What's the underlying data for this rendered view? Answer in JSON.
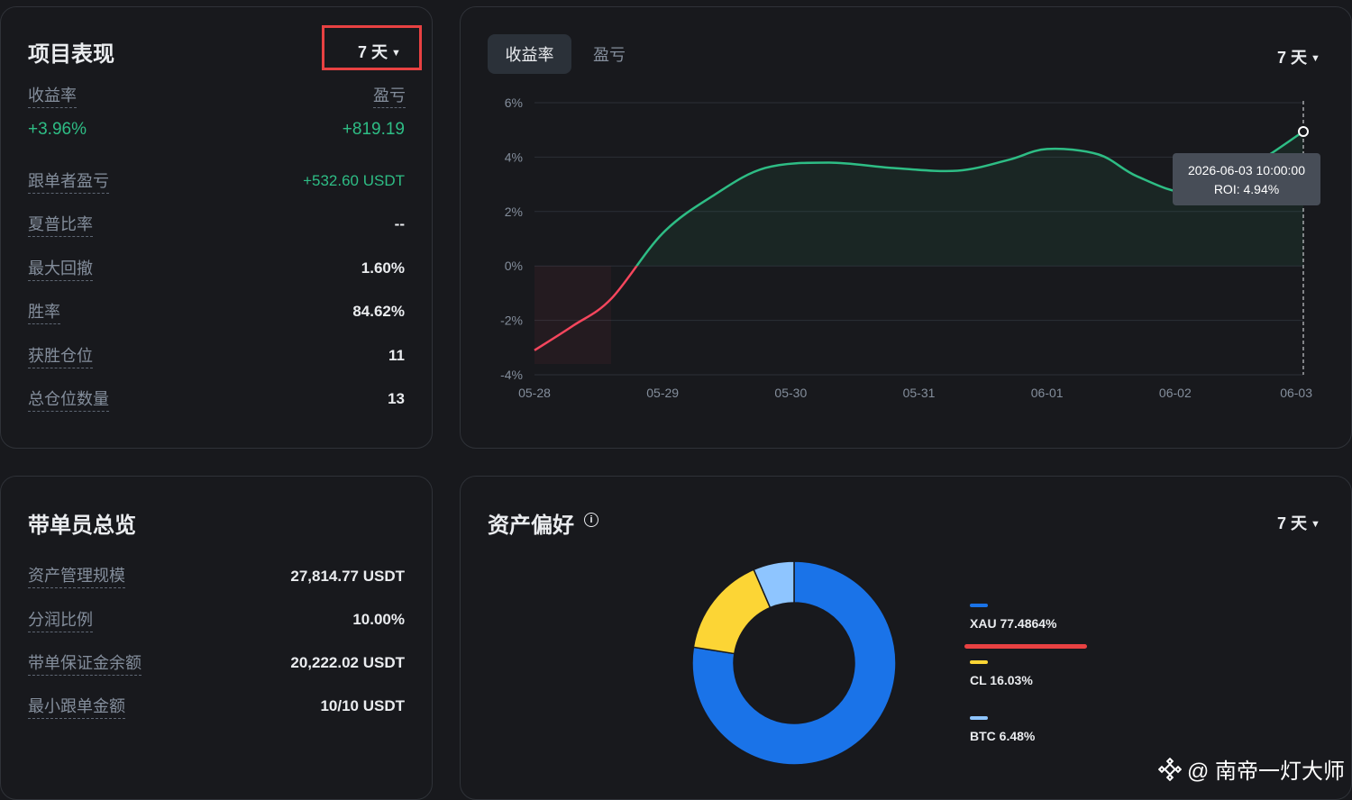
{
  "performance": {
    "title": "项目表现",
    "period": "7 天",
    "roi_label": "收益率",
    "pnl_label": "盈亏",
    "roi_value": "+3.96%",
    "pnl_value": "+819.19",
    "rows": [
      {
        "label": "跟单者盈亏",
        "value": "+532.60 USDT"
      },
      {
        "label": "夏普比率",
        "value": "--"
      },
      {
        "label": "最大回撤",
        "value": "1.60%"
      },
      {
        "label": "胜率",
        "value": "84.62%"
      },
      {
        "label": "获胜仓位",
        "value": "11"
      },
      {
        "label": "总仓位数量",
        "value": "13"
      }
    ]
  },
  "chart_panel": {
    "tab_active": "收益率",
    "tab_inactive": "盈亏",
    "period": "7 天",
    "tooltip_time": "2026-06-03 10:00:00",
    "tooltip_value": "ROI: 4.94%"
  },
  "chart_data": {
    "type": "line",
    "title": "",
    "xlabel": "",
    "ylabel": "",
    "x_ticks": [
      "05-28",
      "05-29",
      "05-30",
      "05-31",
      "06-01",
      "06-02",
      "06-03"
    ],
    "y_ticks": [
      "6%",
      "4%",
      "2%",
      "0%",
      "-2%",
      "-4%"
    ],
    "ylim": [
      -4,
      6
    ],
    "series": [
      {
        "x": [
          0,
          0.3,
          0.6,
          1.0,
          1.4,
          1.8,
          2.3,
          2.8,
          3.3,
          3.7,
          4.0,
          4.4,
          4.7,
          5.1,
          5.5,
          6.0
        ],
        "y": [
          -3.1,
          -2.2,
          -1.2,
          1.2,
          2.6,
          3.6,
          3.8,
          3.6,
          3.5,
          3.9,
          4.3,
          4.1,
          3.3,
          2.7,
          3.4,
          4.94
        ]
      }
    ],
    "grid": true,
    "positive_color": "#2ebd85",
    "negative_color": "#f6465d"
  },
  "overview": {
    "title": "带单员总览",
    "rows": [
      {
        "label": "资产管理规模",
        "value": "27,814.77 USDT"
      },
      {
        "label": "分润比例",
        "value": "10.00%"
      },
      {
        "label": "带单保证金余额",
        "value": "20,222.02 USDT"
      },
      {
        "label": "最小跟单金额",
        "value": "10/10 USDT"
      }
    ]
  },
  "assets": {
    "title": "资产偏好",
    "info_icon": "i",
    "period": "7 天",
    "legend": [
      {
        "label": "XAU 77.4864%",
        "value": 77.4864,
        "color": "#1a73e8"
      },
      {
        "label": "CL 16.03%",
        "value": 16.03,
        "color": "#fcd535"
      },
      {
        "label": "BTC 6.48%",
        "value": 6.48,
        "color": "#8ec5ff"
      }
    ]
  },
  "watermark": "@ 南帝一灯大师"
}
